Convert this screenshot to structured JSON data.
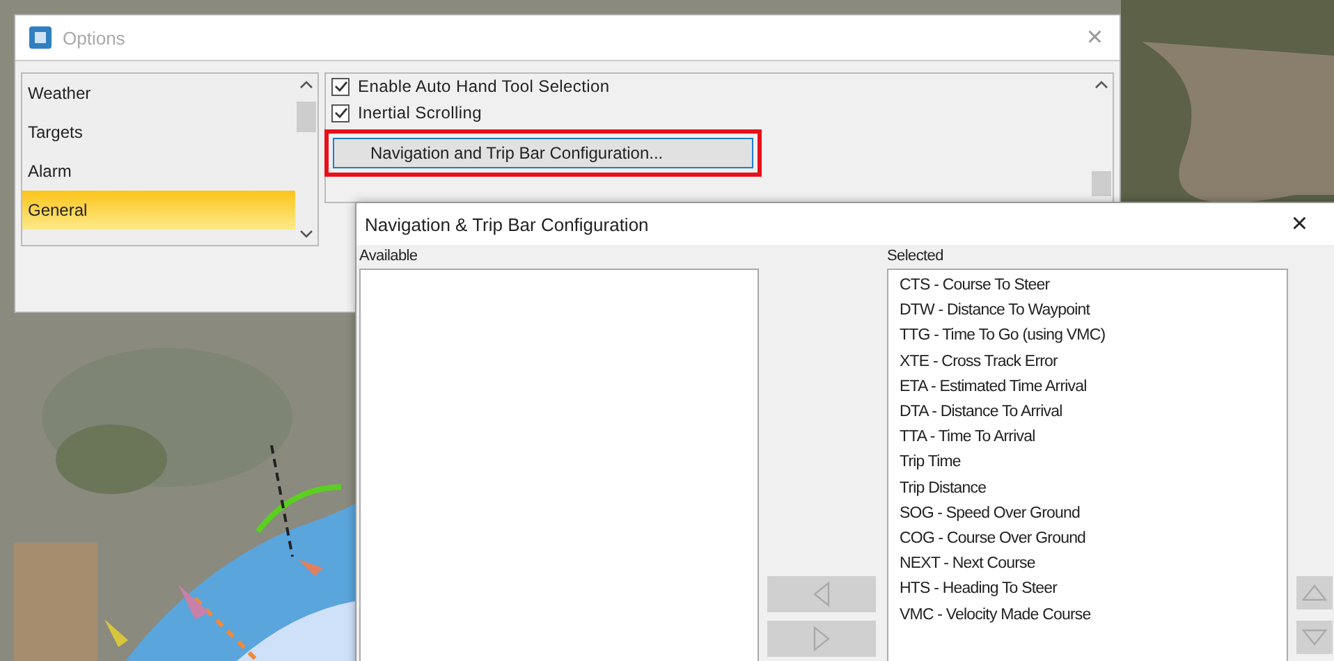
{
  "options_window": {
    "title": "Options",
    "close": "×",
    "categories": [
      {
        "label": "Weather",
        "selected": false
      },
      {
        "label": "Targets",
        "selected": false
      },
      {
        "label": "Alarm",
        "selected": false
      },
      {
        "label": "General",
        "selected": true
      }
    ],
    "settings": [
      {
        "label": "Enable Auto Hand Tool Selection",
        "checked": true
      },
      {
        "label": "Inertial Scrolling",
        "checked": true
      }
    ],
    "config_button": {
      "label": "Navigation and Trip Bar Configuration...",
      "highlighted": true
    }
  },
  "config_dialog": {
    "title": "Navigation & Trip Bar Configuration",
    "close": "×",
    "available_label": "Available",
    "selected_label": "Selected",
    "selected_items": [
      "CTS - Course To Steer",
      "DTW - Distance To Waypoint",
      "TTG - Time To Go (using VMC)",
      "XTE - Cross Track Error",
      "ETA - Estimated Time Arrival",
      "DTA - Distance To Arrival",
      "TTA - Time To Arrival",
      "Trip Time",
      "Trip Distance",
      "SOG - Speed Over Ground",
      "COG - Course Over Ground",
      "NEXT - Next Course",
      "HTS - Heading To Steer",
      "VMC - Velocity Made Course"
    ],
    "move_buttons": [
      {
        "kind": "left",
        "disabled": true
      },
      {
        "kind": "right",
        "disabled": true
      }
    ],
    "order_buttons": [
      {
        "kind": "up",
        "disabled": true
      },
      {
        "kind": "down",
        "disabled": true
      }
    ]
  }
}
